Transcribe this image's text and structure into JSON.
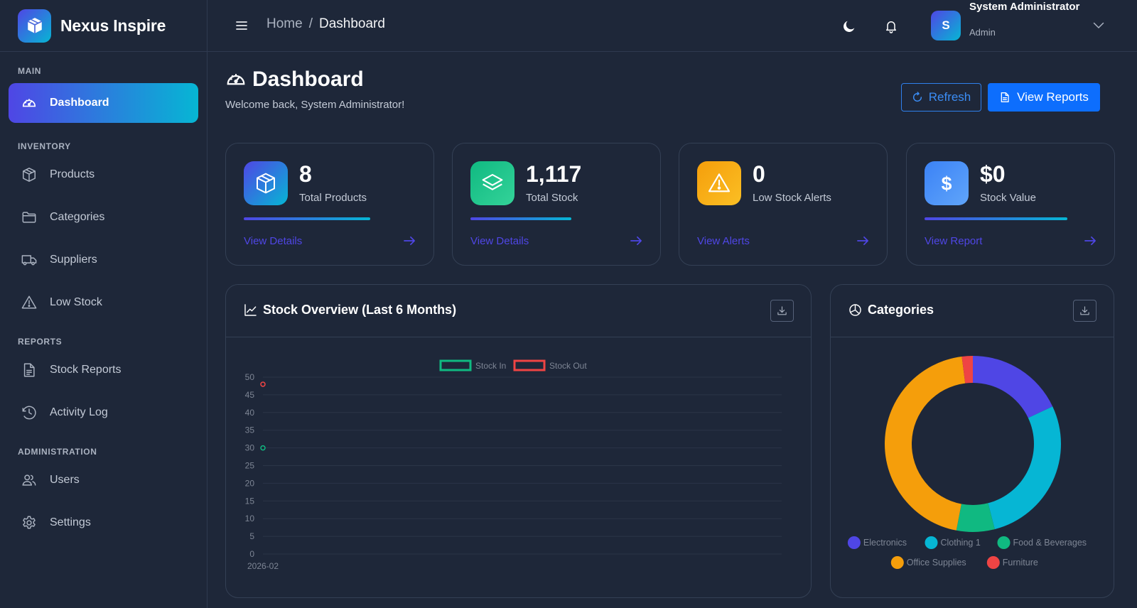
{
  "app": {
    "name": "Nexus Inspire"
  },
  "sidebar": {
    "sections": [
      {
        "title": "MAIN",
        "items": [
          {
            "label": "Dashboard",
            "icon": "gauge-icon",
            "active": true
          }
        ]
      },
      {
        "title": "INVENTORY",
        "items": [
          {
            "label": "Products",
            "icon": "box-icon"
          },
          {
            "label": "Categories",
            "icon": "folder-icon"
          },
          {
            "label": "Suppliers",
            "icon": "truck-icon"
          },
          {
            "label": "Low Stock",
            "icon": "warning-icon"
          }
        ]
      },
      {
        "title": "REPORTS",
        "items": [
          {
            "label": "Stock Reports",
            "icon": "file-icon"
          },
          {
            "label": "Activity Log",
            "icon": "clock-icon"
          }
        ]
      },
      {
        "title": "ADMINISTRATION",
        "items": [
          {
            "label": "Users",
            "icon": "users-icon"
          },
          {
            "label": "Settings",
            "icon": "gear-icon"
          }
        ]
      }
    ]
  },
  "topbar": {
    "breadcrumb_home": "Home",
    "breadcrumb_sep": "/",
    "breadcrumb_current": "Dashboard",
    "user_initial": "S",
    "user_name": "System Administrator",
    "user_role": "Admin"
  },
  "page": {
    "title": "Dashboard",
    "subtitle": "Welcome back, System Administrator!",
    "refresh_label": "Refresh",
    "reports_label": "View Reports"
  },
  "stats": [
    {
      "value": "8",
      "label": "Total Products",
      "link": "View Details",
      "color": "#4f46e5",
      "icon": "box-icon",
      "bar_fraction": 0.69
    },
    {
      "value": "1,117",
      "label": "Total Stock",
      "link": "View Details",
      "color": "#10b981",
      "icon": "layers-icon",
      "bar_fraction": 0.55
    },
    {
      "value": "0",
      "label": "Low Stock Alerts",
      "link": "View Alerts",
      "color": "#f59e0b",
      "icon": "warning-icon",
      "bar_fraction": 0
    },
    {
      "value": "$0",
      "label": "Stock Value",
      "link": "View Report",
      "color": "#3b82f6",
      "icon": "dollar-icon",
      "bar_fraction": 0.78
    }
  ],
  "panels": {
    "stock_title": "Stock Overview (Last 6 Months)",
    "categories_title": "Categories"
  },
  "chart_data": [
    {
      "type": "line",
      "title": "Stock Overview (Last 6 Months)",
      "x": [
        "2026-02"
      ],
      "series": [
        {
          "name": "Stock In",
          "values": [
            30
          ],
          "color": "#10b981"
        },
        {
          "name": "Stock Out",
          "values": [
            48
          ],
          "color": "#ef4444"
        }
      ],
      "ylim": [
        0,
        50
      ],
      "yticks": [
        0,
        5,
        10,
        15,
        20,
        25,
        30,
        35,
        40,
        45,
        50
      ],
      "legend": "top-center",
      "grid": true
    },
    {
      "type": "pie",
      "title": "Categories",
      "donut": true,
      "labels": [
        "Electronics",
        "Clothing 1",
        "Food & Beverages",
        "Office Supplies",
        "Furniture"
      ],
      "values": [
        18,
        28,
        7,
        45,
        2
      ],
      "colors": [
        "#4f46e5",
        "#06b6d4",
        "#10b981",
        "#f59e0b",
        "#ef4444"
      ],
      "legend": "bottom"
    }
  ]
}
